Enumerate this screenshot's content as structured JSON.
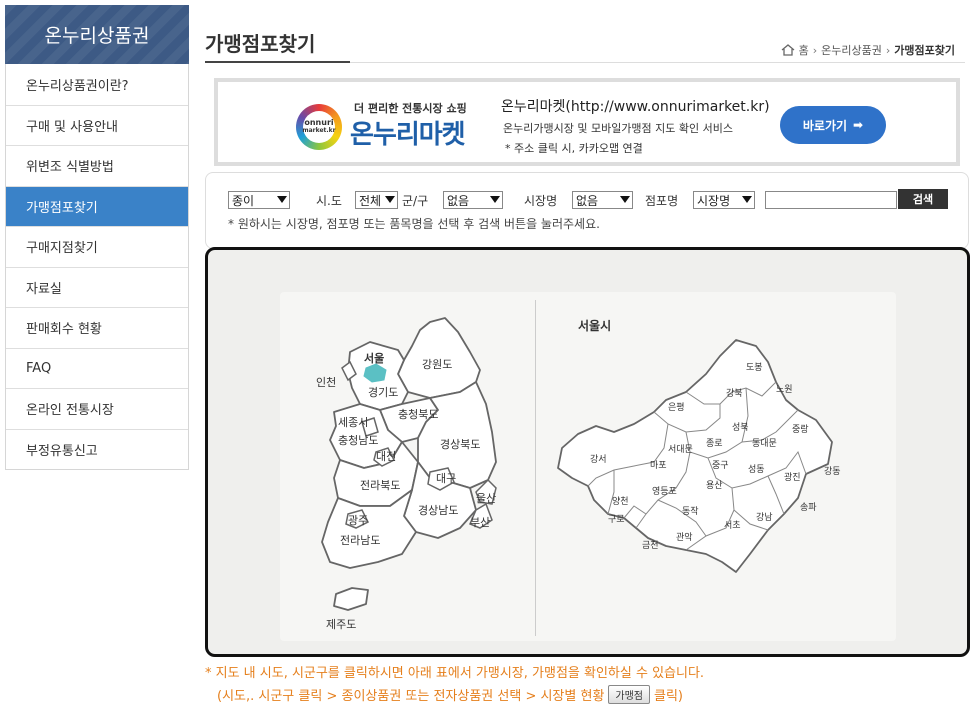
{
  "sidebar": {
    "title": "온누리상품권",
    "items": [
      {
        "label": "온누리상품권이란?"
      },
      {
        "label": "구매 및 사용안내"
      },
      {
        "label": "위변조 식별방법"
      },
      {
        "label": "가맹점포찾기"
      },
      {
        "label": "구매지점찾기"
      },
      {
        "label": "자료실"
      },
      {
        "label": "판매회수 현황"
      },
      {
        "label": "FAQ"
      },
      {
        "label": "온라인 전통시장"
      },
      {
        "label": "부정유통신고"
      }
    ],
    "active_index": 3,
    "active_color": "#3a82c8",
    "header_color": "#3d5a85"
  },
  "header": {
    "title": "가맹점포찾기",
    "breadcrumb": [
      "홈",
      "온누리상품권",
      "가맹점포찾기"
    ]
  },
  "banner": {
    "logo_sub": "더 편리한 전통시장 쇼핑",
    "logo_main": "온누리마켓",
    "logo_badge_top": "onnuri",
    "logo_badge_bottom": "market.kr",
    "title": "온누리마켓(http://www.onnurimarket.kr)",
    "desc": "온누리가맹시장 및 모바일가맹점 지도 확인 서비스",
    "note": "* 주소 클릭 시, 카카오맵 연결",
    "button": "바로가기",
    "button_color": "#2f72c9"
  },
  "search": {
    "type_value": "종이",
    "sido_label": "시.도",
    "sido_value": "전체",
    "gugun_label": "군/구",
    "gugun_value": "없음",
    "market_label": "시장명",
    "market_value": "없음",
    "store_label": "점포명",
    "store_value": "시장명",
    "input_value": "",
    "button": "검색",
    "hint": "* 원하시는 시장명, 점포명 또는 품목명을 선택 후 검색 버튼을 눌러주세요."
  },
  "map": {
    "korea_regions": [
      "서울",
      "인천",
      "강원도",
      "경기도",
      "충청북도",
      "세종시",
      "충청남도",
      "대전",
      "경상북도",
      "전라북도",
      "대구",
      "울산",
      "경상남도",
      "부산",
      "광주",
      "전라남도",
      "제주도"
    ],
    "seoul_title": "서울시",
    "seoul_districts": [
      "도봉",
      "강북",
      "노원",
      "은평",
      "성북",
      "중랑",
      "종로",
      "동대문",
      "서대문",
      "강서",
      "마포",
      "중구",
      "성동",
      "광진",
      "강동",
      "용산",
      "영등포",
      "양천",
      "구로",
      "동작",
      "서초",
      "강남",
      "송파",
      "관악",
      "금천"
    ],
    "selected_color": "#5bc0c4",
    "active_border": "#6fae22"
  },
  "footnote": {
    "line1": "* 지도 내 시도, 시군구를 클릭하시면 아래 표에서 가맹시장, 가맹점을 확인하실 수 있습니다.",
    "line2_prefix": "(시도,. 시군구 클릭 > 종이상품권 또는 전자상품권 선택 > 시장별 현황",
    "line2_button": "가맹점",
    "line2_suffix": "클릭)"
  }
}
